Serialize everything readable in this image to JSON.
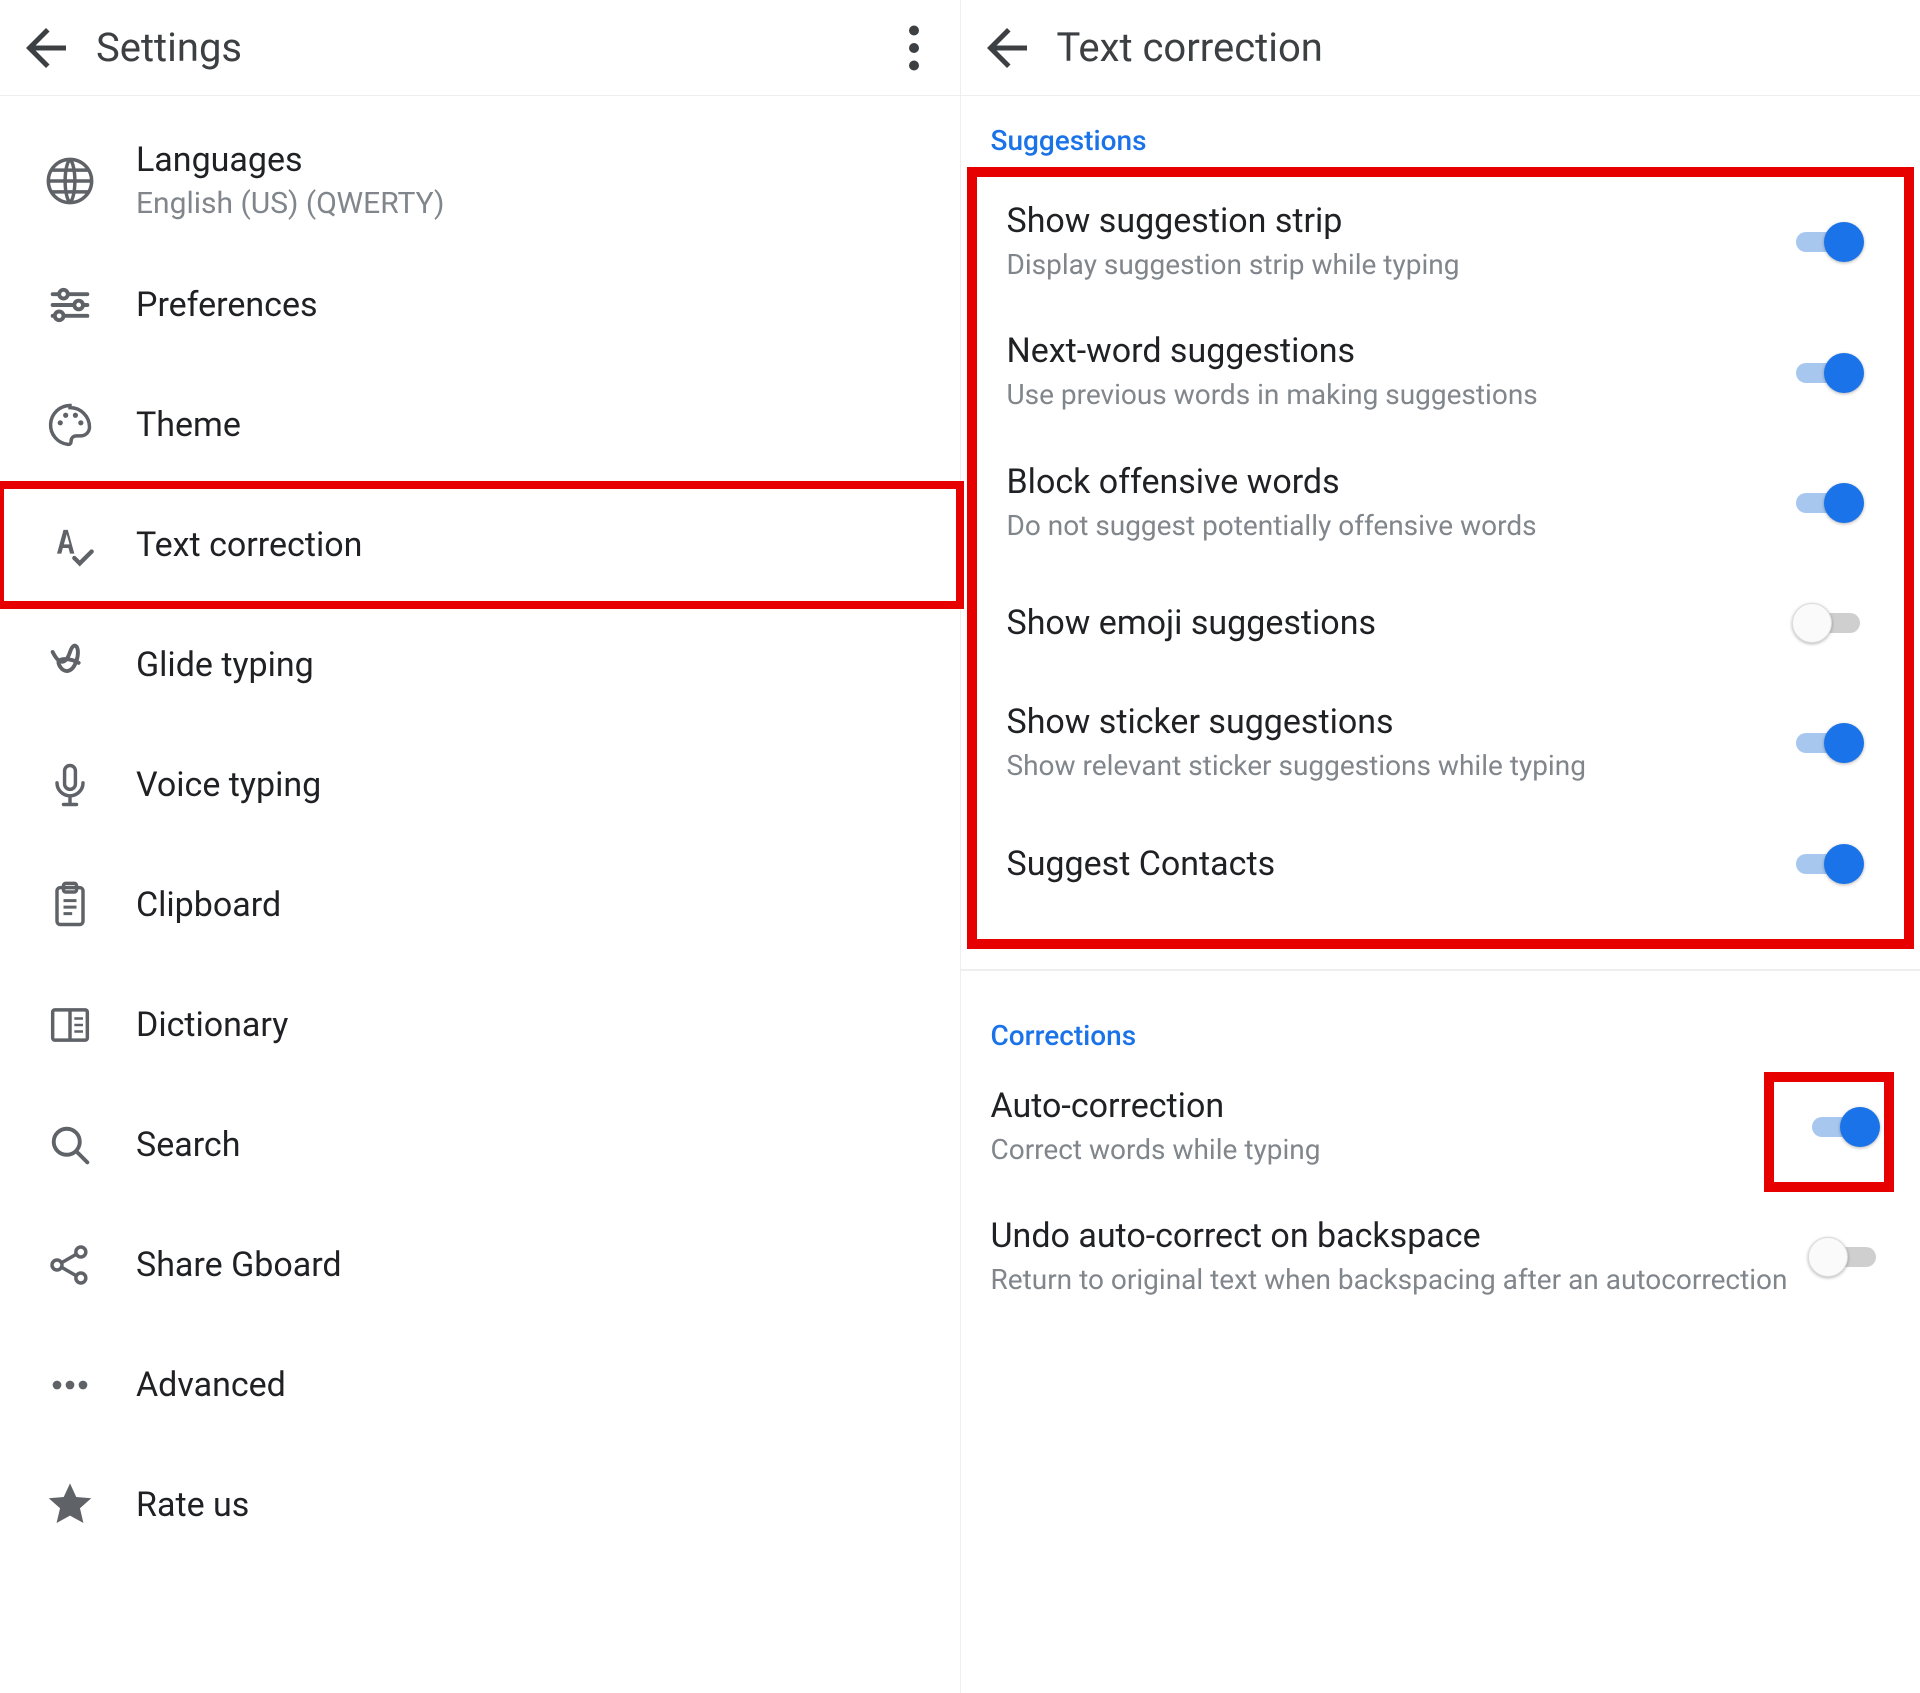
{
  "left": {
    "title": "Settings",
    "items": [
      {
        "id": "languages",
        "label": "Languages",
        "sub": "English (US) (QWERTY)"
      },
      {
        "id": "preferences",
        "label": "Preferences",
        "sub": ""
      },
      {
        "id": "theme",
        "label": "Theme",
        "sub": ""
      },
      {
        "id": "textcorr",
        "label": "Text correction",
        "sub": ""
      },
      {
        "id": "glide",
        "label": "Glide typing",
        "sub": ""
      },
      {
        "id": "voice",
        "label": "Voice typing",
        "sub": ""
      },
      {
        "id": "clipboard",
        "label": "Clipboard",
        "sub": ""
      },
      {
        "id": "dictionary",
        "label": "Dictionary",
        "sub": ""
      },
      {
        "id": "search",
        "label": "Search",
        "sub": ""
      },
      {
        "id": "share",
        "label": "Share Gboard",
        "sub": ""
      },
      {
        "id": "advanced",
        "label": "Advanced",
        "sub": ""
      },
      {
        "id": "rateus",
        "label": "Rate us",
        "sub": ""
      }
    ]
  },
  "right": {
    "title": "Text correction",
    "section1": "Suggestions",
    "section2": "Corrections",
    "suggestions": [
      {
        "t": "Show suggestion strip",
        "s": "Display suggestion strip while typing",
        "on": true
      },
      {
        "t": "Next-word suggestions",
        "s": "Use previous words in making suggestions",
        "on": true
      },
      {
        "t": "Block offensive words",
        "s": "Do not suggest potentially offensive words",
        "on": true
      },
      {
        "t": "Show emoji suggestions",
        "s": "",
        "on": false
      },
      {
        "t": "Show sticker suggestions",
        "s": "Show relevant sticker suggestions while typing",
        "on": true
      },
      {
        "t": "Suggest Contacts",
        "s": "",
        "on": true
      }
    ],
    "corrections": [
      {
        "t": "Auto-correction",
        "s": "Correct words while typing",
        "on": true
      },
      {
        "t": "Undo auto-correct on backspace",
        "s": "Return to original text when backspacing after an autocorrection",
        "on": false
      }
    ]
  }
}
